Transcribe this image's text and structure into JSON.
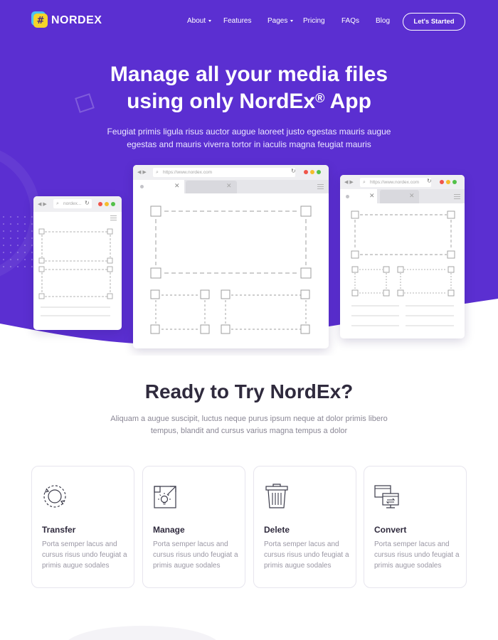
{
  "brand": {
    "logo_glyph": "#",
    "name": "NORDEX",
    "primary_color": "#5b2fd1",
    "accent_yellow": "#f4d32a",
    "accent_blue": "#4cc3f0"
  },
  "nav": {
    "items": [
      {
        "label": "About",
        "has_dropdown": true
      },
      {
        "label": "Features",
        "has_dropdown": false
      },
      {
        "label": "Pages",
        "has_dropdown": true
      },
      {
        "label": "Pricing",
        "has_dropdown": false
      },
      {
        "label": "FAQs",
        "has_dropdown": false
      },
      {
        "label": "Blog",
        "has_dropdown": false
      }
    ],
    "cta_label": "Let's Started"
  },
  "hero": {
    "title_line1": "Manage all your media files",
    "title_line2_prefix": "using only ",
    "title_line2_brand": "NordEx",
    "title_line2_reg": "®",
    "title_line2_suffix": " App",
    "subtitle": "Feugiat primis ligula risus auctor augue laoreet justo egestas mauris augue egestas and mauris viverra tortor in iaculis magna feugiat mauris"
  },
  "browsers": {
    "left_url": "nordex...",
    "center_url": "https://www.nordex.com",
    "right_url": "https://www.nordex.com"
  },
  "section": {
    "title": "Ready to Try NordEx?",
    "subtitle": "Aliquam a augue suscipit, luctus neque purus ipsum neque at dolor primis libero tempus, blandit and cursus varius magna tempus a dolor"
  },
  "features": [
    {
      "icon": "transfer-icon",
      "title": "Transfer",
      "text": "Porta semper lacus and cursus risus undo feugiat a primis augue sodales"
    },
    {
      "icon": "manage-icon",
      "title": "Manage",
      "text": "Porta semper lacus and cursus risus undo feugiat a primis augue sodales"
    },
    {
      "icon": "trash-icon",
      "title": "Delete",
      "text": "Porta semper lacus and cursus risus undo feugiat a primis augue sodales"
    },
    {
      "icon": "convert-icon",
      "title": "Convert",
      "text": "Porta semper lacus and cursus risus undo feugiat a primis augue sodales"
    }
  ]
}
